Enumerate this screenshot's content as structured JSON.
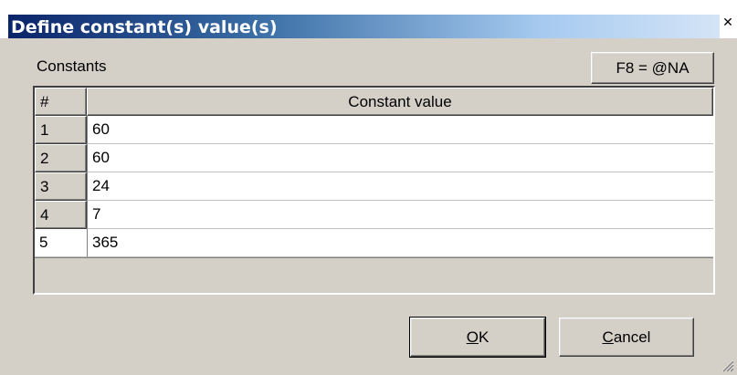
{
  "window": {
    "title": "Define constant(s) value(s)",
    "close_glyph": "✕"
  },
  "constants_label": "Constants",
  "f8_button_label": "F8 = @NA",
  "table": {
    "headers": [
      "#",
      "Constant value"
    ],
    "rows": [
      {
        "num": "1",
        "value": "60"
      },
      {
        "num": "2",
        "value": "60"
      },
      {
        "num": "3",
        "value": "24"
      },
      {
        "num": "4",
        "value": "7"
      },
      {
        "num": "5",
        "value": "365"
      }
    ]
  },
  "buttons": {
    "ok_label": "OK",
    "ok_mnemonic": "O",
    "ok_rest": "K",
    "cancel_label": "Cancel",
    "cancel_mnemonic": "C",
    "cancel_rest": "ancel"
  }
}
